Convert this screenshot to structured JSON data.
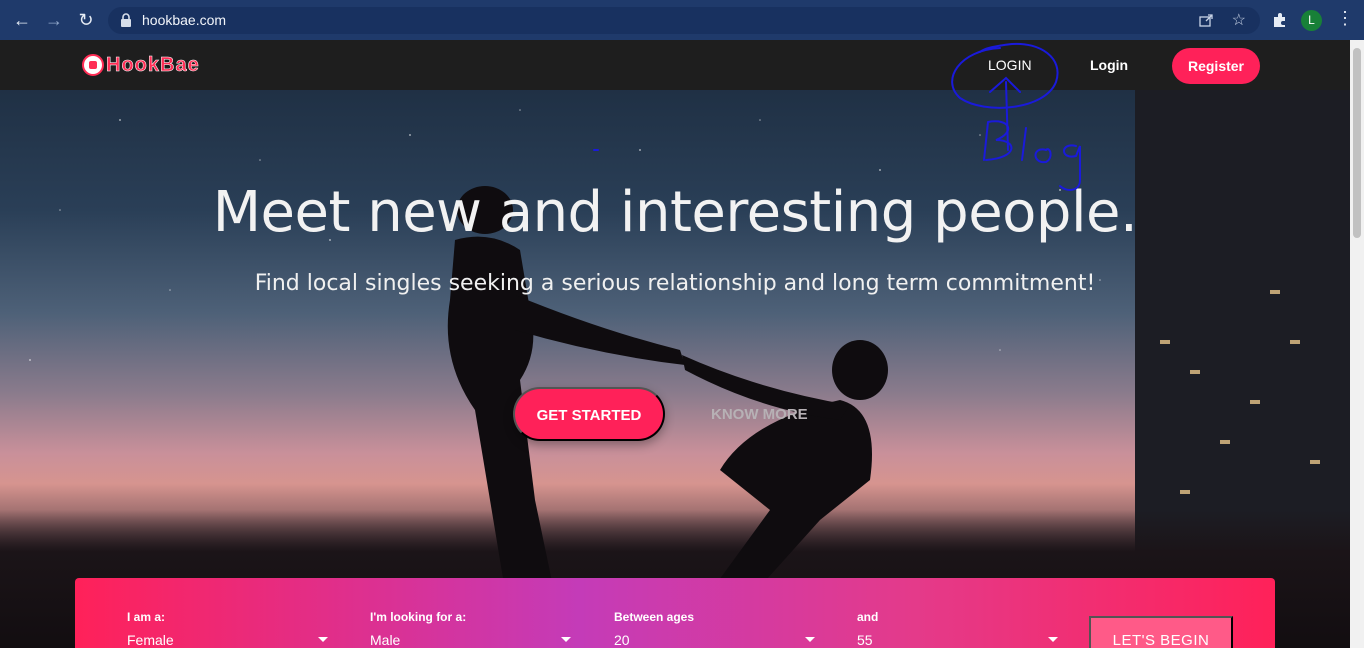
{
  "browser": {
    "url": "hookbae.com",
    "profile_initial": "L"
  },
  "header": {
    "logo_text": "HookBae",
    "nav": {
      "blog_label": "LOGIN",
      "login_label": "Login",
      "register_label": "Register"
    }
  },
  "hero": {
    "headline": "Meet new and interesting people.",
    "subhead": "Find local singles seeking a serious relationship and long term commitment!",
    "cta_label": "GET STARTED",
    "secondary_label": "KNOW MORE"
  },
  "search": {
    "iam_label": "I am a:",
    "iam_value": "Female",
    "looking_label": "I'm looking for a:",
    "looking_value": "Male",
    "ages_label": "Between ages",
    "age_min": "20",
    "and_label": "and",
    "age_max": "55",
    "submit_label": "LET'S BEGIN"
  },
  "annotation": {
    "handwritten_text": "Blog"
  },
  "colors": {
    "brand": "#ff2159",
    "header_bg": "#1e1e1e",
    "chrome_bg": "#1f3a6b",
    "annotation_ink": "#1a1adb"
  },
  "icons": [
    "back-icon",
    "forward-icon",
    "reload-icon",
    "lock-icon",
    "share-icon",
    "star-icon",
    "extensions-icon",
    "menu-icon",
    "caret-down-icon"
  ]
}
